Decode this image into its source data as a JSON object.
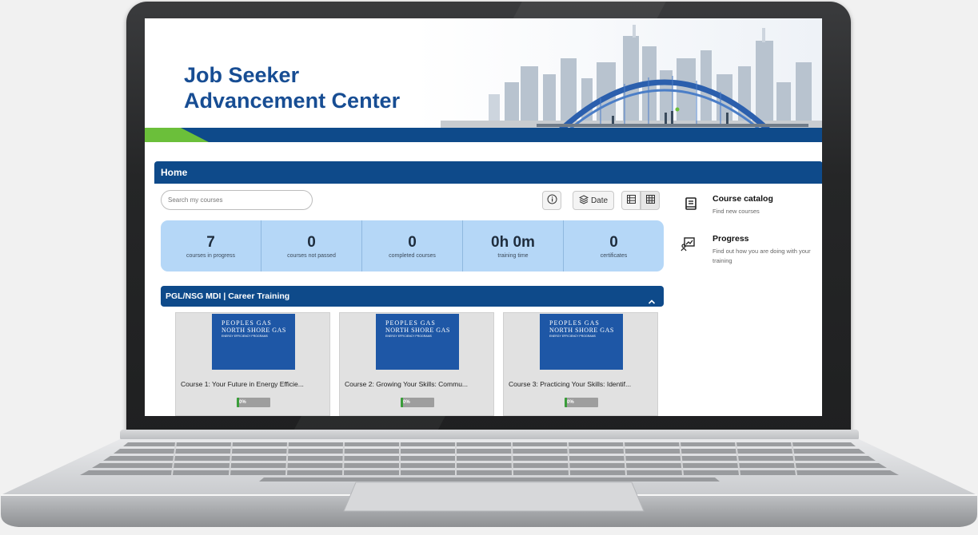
{
  "banner": {
    "title_line1": "Job Seeker",
    "title_line2": "Advancement Center",
    "colors": {
      "title": "#174d93",
      "stripe_blue": "#0e4a8a",
      "stripe_green": "#6bbf3a"
    }
  },
  "nav": {
    "home": "Home"
  },
  "search": {
    "placeholder": "Search my courses"
  },
  "toolbar": {
    "info_icon": "info-icon",
    "sort_icon": "layers-icon",
    "sort_label": "Date",
    "list_view_icon": "list-view-icon",
    "grid_view_icon": "grid-view-icon"
  },
  "stats": [
    {
      "value": "7",
      "label": "courses in progress"
    },
    {
      "value": "0",
      "label": "courses not passed"
    },
    {
      "value": "0",
      "label": "completed courses"
    },
    {
      "value": "0h 0m",
      "label": "training time"
    },
    {
      "value": "0",
      "label": "certificates"
    }
  ],
  "sidebar": {
    "catalog": {
      "title": "Course catalog",
      "subtitle": "Find new courses",
      "icon": "book-icon"
    },
    "progress": {
      "title": "Progress",
      "subtitle": "Find out how you are doing with your training",
      "icon": "progress-chart-icon"
    }
  },
  "group": {
    "title": "PGL/NSG MDI | Career Training",
    "toggle_icon": "chevron-up-icon"
  },
  "courses": [
    {
      "title": "Course 1: Your Future in Energy Efficie...",
      "progress": 0,
      "progress_label": "0%",
      "logo_line1": "PEOPLES GAS",
      "logo_line2": "NORTH SHORE GAS",
      "logo_line3": "ENERGY EFFICIENCY PROGRAMS"
    },
    {
      "title": "Course 2: Growing Your Skills: Commu...",
      "progress": 0,
      "progress_label": "0%",
      "logo_line1": "PEOPLES GAS",
      "logo_line2": "NORTH SHORE GAS",
      "logo_line3": "ENERGY EFFICIENCY PROGRAMS"
    },
    {
      "title": "Course 3: Practicing Your Skills: Identif...",
      "progress": 0,
      "progress_label": "0%",
      "logo_line1": "PEOPLES GAS",
      "logo_line2": "NORTH SHORE GAS",
      "logo_line3": "ENERGY EFFICIENCY PROGRAMS"
    }
  ]
}
